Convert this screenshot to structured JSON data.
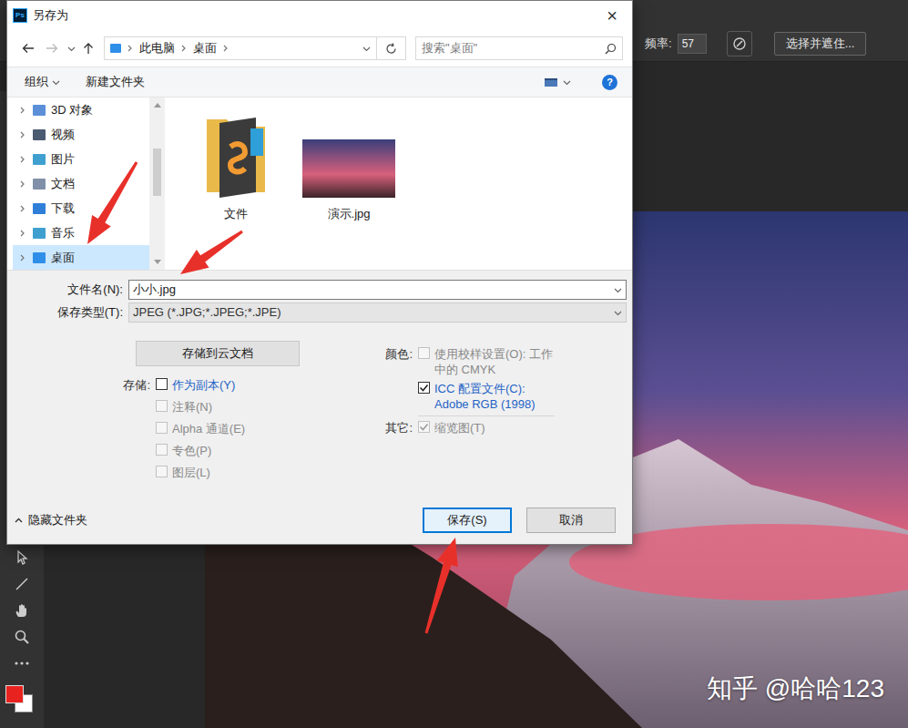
{
  "app": {
    "options_bar": {
      "frequency_label": "频率:",
      "frequency_value": "57",
      "select_and_mask": "选择并遮住..."
    },
    "swatches": [
      {
        "color": "#e8231f"
      },
      {
        "color": "#ffffff"
      }
    ]
  },
  "dialog": {
    "app_icon": "Ps",
    "title": "另存为",
    "close": "×",
    "breadcrumb": [
      "此电脑",
      "桌面"
    ],
    "search": {
      "placeholder": "搜索\"桌面\""
    },
    "toolbar": {
      "organize": "组织",
      "new_folder": "新建文件夹",
      "help": "?"
    },
    "nav": [
      {
        "label": "3D 对象",
        "selected": false
      },
      {
        "label": "视频",
        "selected": false
      },
      {
        "label": "图片",
        "selected": false
      },
      {
        "label": "文档",
        "selected": false
      },
      {
        "label": "下载",
        "selected": false
      },
      {
        "label": "音乐",
        "selected": false
      },
      {
        "label": "桌面",
        "selected": true
      }
    ],
    "files": [
      {
        "name": "文件",
        "kind": "folder"
      },
      {
        "name": "演示.jpg",
        "kind": "image"
      }
    ],
    "file_name": {
      "label": "文件名(N):",
      "value": "小小.jpg"
    },
    "file_type": {
      "label": "保存类型(T):",
      "value": "JPEG (*.JPG;*.JPEG;*.JPE)"
    },
    "cloud_button": "存储到云文档",
    "save_group": {
      "label": "存储:",
      "options": [
        {
          "label": "作为副本(Y)",
          "checked": false,
          "disabled": false
        },
        {
          "label": "注释(N)",
          "checked": false,
          "disabled": true
        },
        {
          "label": "Alpha 通道(E)",
          "checked": false,
          "disabled": true
        },
        {
          "label": "专色(P)",
          "checked": false,
          "disabled": true
        },
        {
          "label": "图层(L)",
          "checked": false,
          "disabled": true
        }
      ]
    },
    "color_group": {
      "label": "颜色:",
      "options": [
        {
          "label": "使用校样设置(O): 工作中的 CMYK",
          "checked": false,
          "disabled": true
        },
        {
          "label": "ICC 配置文件(C): Adobe RGB (1998)",
          "checked": true,
          "disabled": false
        }
      ]
    },
    "other_group": {
      "label": "其它:",
      "options": [
        {
          "label": "缩览图(T)",
          "checked": true,
          "disabled": true
        }
      ]
    },
    "hide_folders": "隐藏文件夹",
    "buttons": [
      {
        "label": "保存(S)",
        "focused": true
      },
      {
        "label": "取消",
        "focused": false
      }
    ]
  },
  "watermark": "知乎 @哈哈123"
}
